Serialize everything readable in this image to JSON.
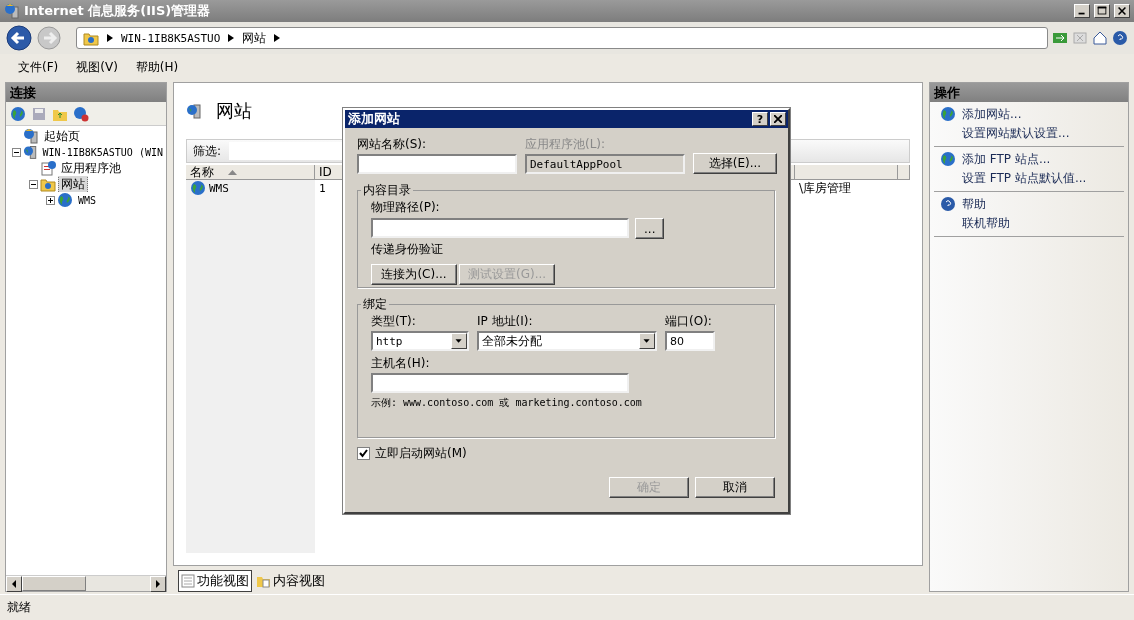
{
  "window": {
    "title": "Internet 信息服务(IIS)管理器"
  },
  "address": {
    "segments": [
      "WIN-1IB8K5ASTUO",
      "网站"
    ]
  },
  "menu": [
    "文件(F)",
    "视图(V)",
    "帮助(H)"
  ],
  "connections": {
    "title": "连接",
    "tree": [
      {
        "label": "起始页",
        "kind": "home",
        "selected": false
      },
      {
        "label": "WIN-1IB8K5ASTUO (WIN",
        "kind": "server",
        "expanded": true,
        "selected": false,
        "children": [
          {
            "label": "应用程序池",
            "kind": "pool",
            "selected": false
          },
          {
            "label": "网站",
            "kind": "folder",
            "expanded": true,
            "selected": true,
            "children": [
              {
                "label": "WMS",
                "kind": "globe",
                "expanded": false,
                "selected": false
              }
            ]
          }
        ]
      }
    ]
  },
  "content": {
    "title": "网站",
    "filter_label": "筛选:",
    "table": {
      "columns": [
        {
          "label": "名称",
          "sorted": true
        },
        {
          "label": "ID",
          "sorted": false
        }
      ],
      "rows": [
        {
          "cells": [
            "WMS",
            "1",
            "\\库房管理"
          ]
        }
      ]
    },
    "view_tabs": [
      {
        "label": "功能视图",
        "kind": "features",
        "selected": true
      },
      {
        "label": "内容视图",
        "kind": "content",
        "selected": false
      }
    ]
  },
  "actions": {
    "title": "操作",
    "groups": [
      {
        "kind": "add",
        "items": [
          "添加网站...",
          "设置网站默认设置..."
        ]
      },
      {
        "kind": "add",
        "items": [
          "添加 FTP 站点...",
          "设置 FTP 站点默认值..."
        ]
      },
      {
        "kind": "help",
        "items": [
          "帮助",
          "联机帮助"
        ]
      }
    ]
  },
  "status_bar": {
    "text": "就绪"
  },
  "dialog": {
    "title": "添加网站",
    "help_button": "?",
    "site_name": {
      "label": "网站名称(S):"
    },
    "app_pool": {
      "label": "应用程序池(L):",
      "value": "DefaultAppPool",
      "disabled": true
    },
    "select_button": "选择(E)...",
    "content_directory": {
      "title": "内容目录",
      "path_label": "物理路径(P):",
      "browse_button": "...",
      "auth_label": "传递身份验证",
      "buttons": [
        {
          "label": "连接为(C)...",
          "disabled": false
        },
        {
          "label": "测试设置(G)...",
          "disabled": true
        }
      ]
    },
    "binding": {
      "title": "绑定",
      "type": {
        "label": "类型(T):",
        "value": "http"
      },
      "ip": {
        "label": "IP 地址(I):",
        "value": "全部未分配"
      },
      "port": {
        "label": "端口(O):",
        "value": "80"
      },
      "host": {
        "label": "主机名(H):"
      },
      "example": "示例: www.contoso.com 或 marketing.contoso.com"
    },
    "start": {
      "label": "立即启动网站(M)",
      "checked": true
    },
    "buttons": [
      {
        "label": "确定",
        "disabled": true
      },
      {
        "label": "取消",
        "disabled": false
      }
    ]
  }
}
